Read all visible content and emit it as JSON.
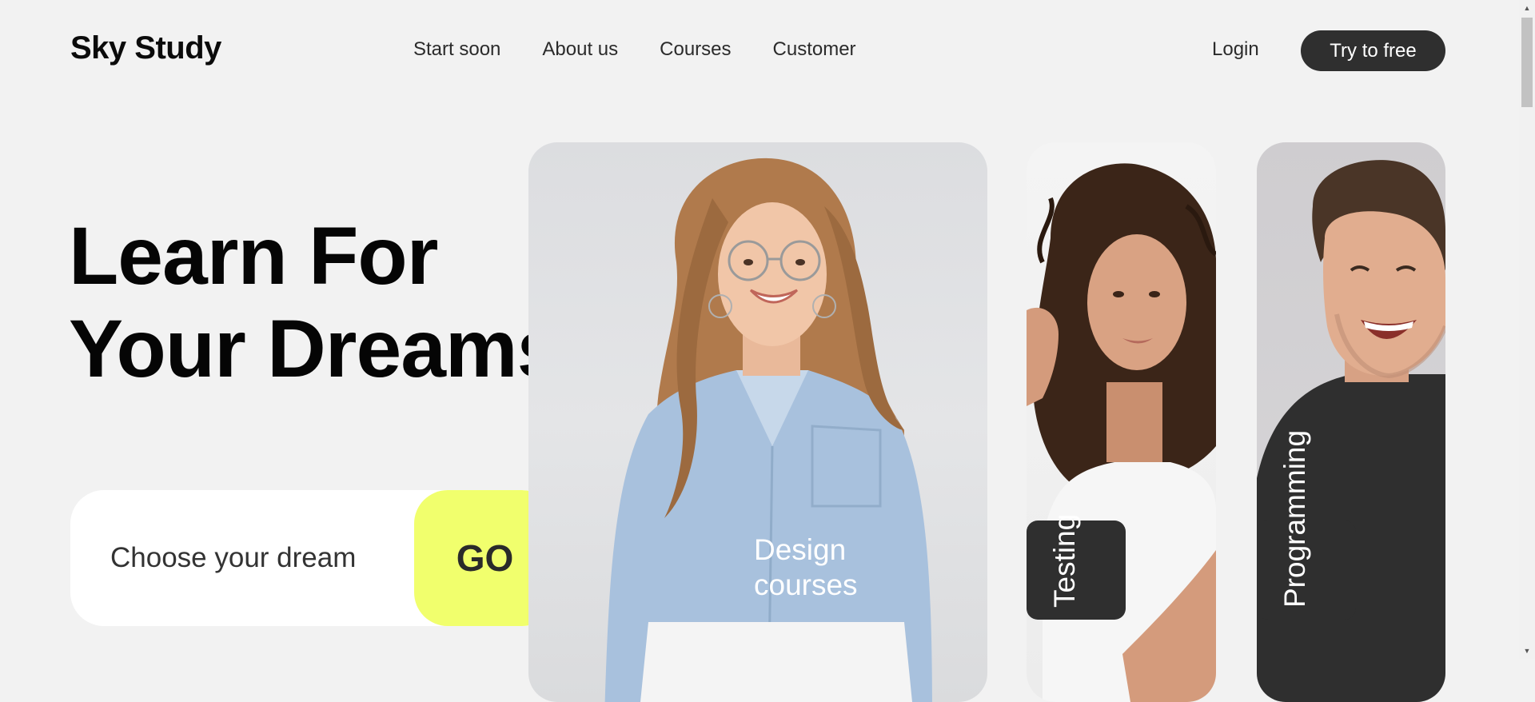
{
  "header": {
    "logo": "Sky Study",
    "nav": [
      "Start soon",
      "About us",
      "Courses",
      "Customer"
    ],
    "login": "Login",
    "cta": "Try to free"
  },
  "hero": {
    "title_line1": "Learn For",
    "title_line2": "Your Dreams"
  },
  "search": {
    "placeholder": "Choose your dream",
    "button": "GO"
  },
  "cards": {
    "design": {
      "line1": "Design",
      "line2": "courses"
    },
    "testing": {
      "label": "Testing"
    },
    "programming": {
      "label": "Programming"
    }
  },
  "colors": {
    "background": "#f2f2f2",
    "dark": "#2f2f2f",
    "accent": "#f1ff6d",
    "white": "#ffffff"
  },
  "icons": {
    "scroll_up": "triangle-up-icon",
    "scroll_down": "triangle-down-icon"
  }
}
